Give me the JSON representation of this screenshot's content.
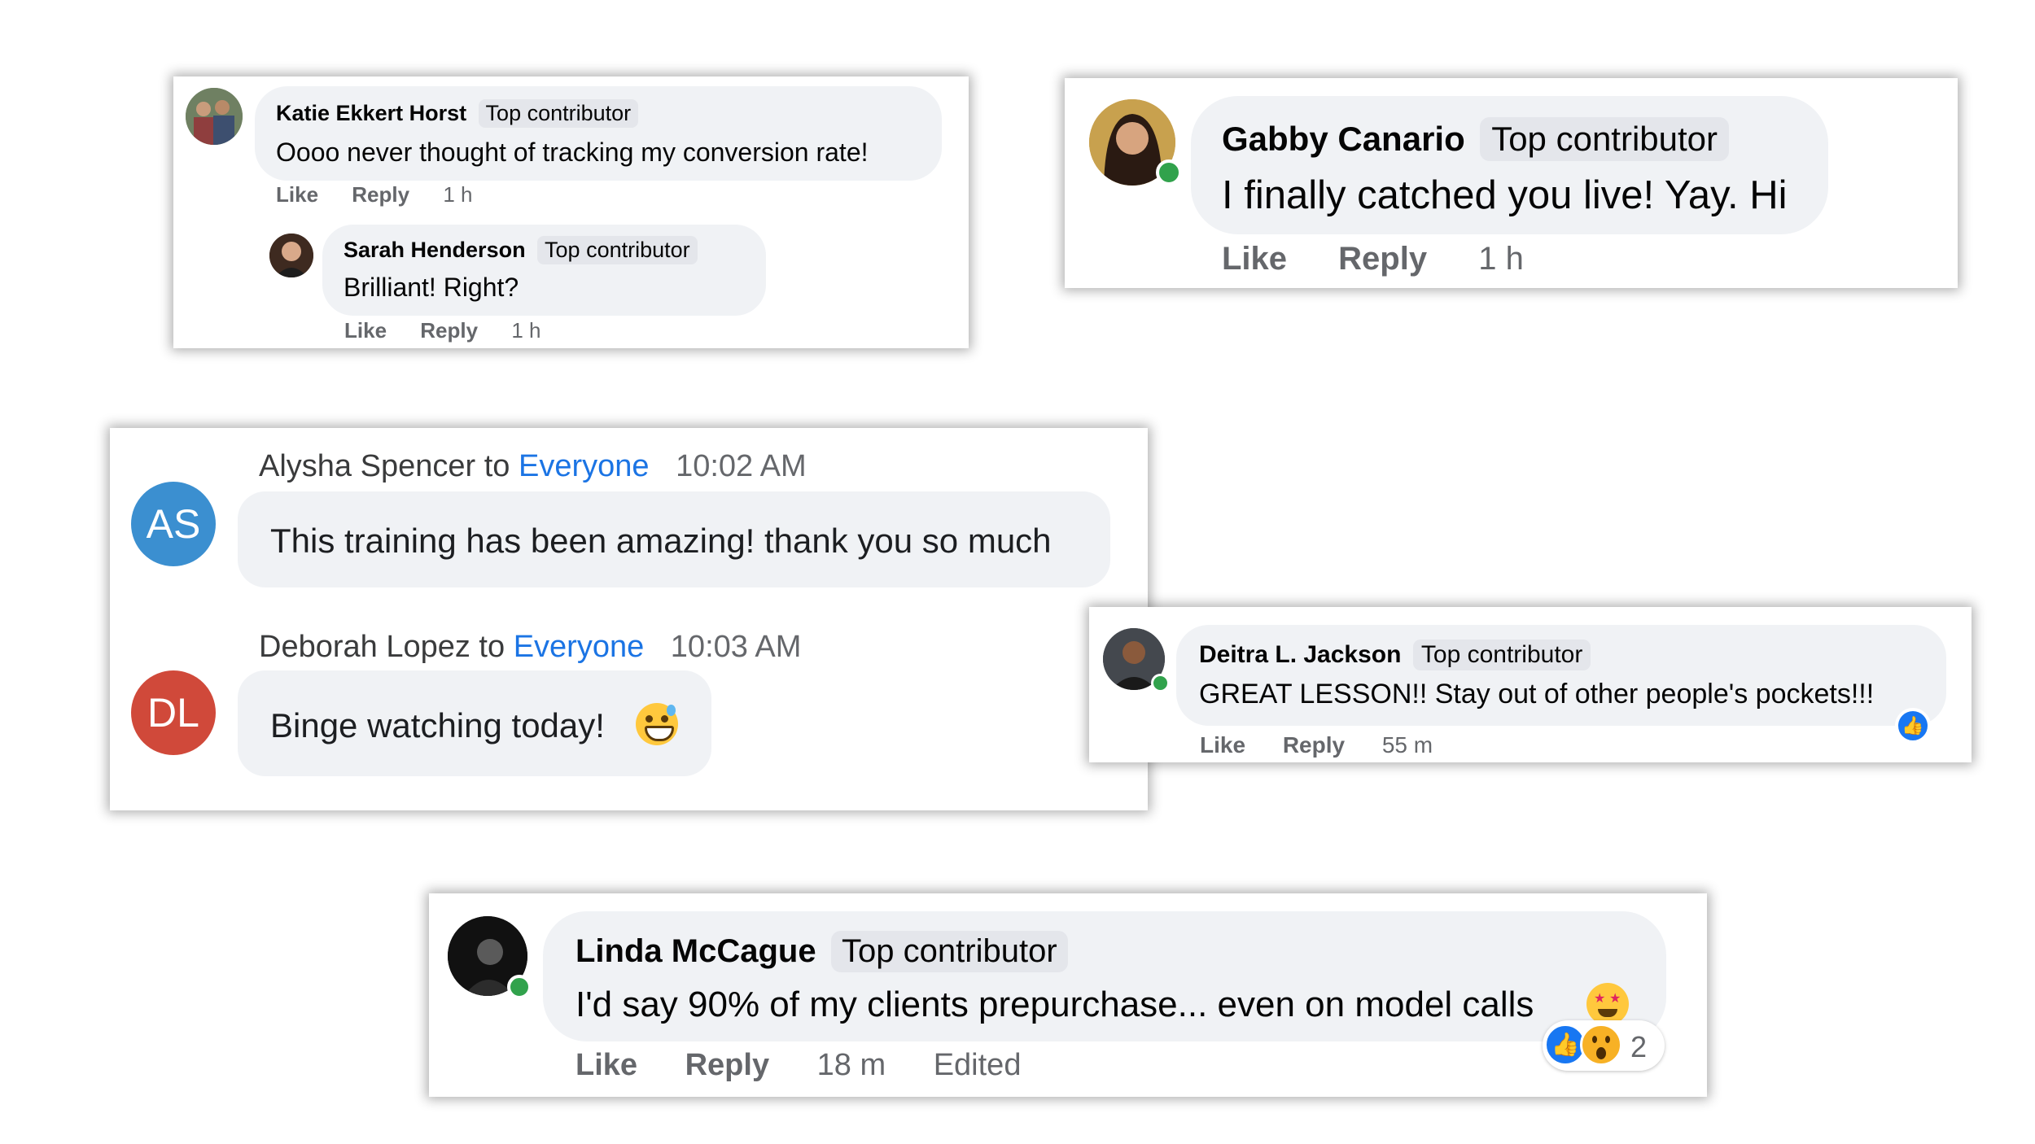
{
  "cards": {
    "katie": {
      "name": "Katie Ekkert Horst",
      "badge": "Top contributor",
      "message": "Oooo never thought of tracking my conversion rate!",
      "like": "Like",
      "reply": "Reply",
      "time": "1 h",
      "reply_comment": {
        "name": "Sarah Henderson",
        "badge": "Top contributor",
        "message": "Brilliant! Right?",
        "like": "Like",
        "reply": "Reply",
        "time": "1 h"
      }
    },
    "gabby": {
      "name": "Gabby Canario",
      "badge": "Top contributor",
      "message": "I finally catched you live! Yay. Hi",
      "like": "Like",
      "reply": "Reply",
      "time": "1 h"
    },
    "chat": {
      "messages": [
        {
          "initials": "AS",
          "sender": "Alysha Spencer",
          "to_word": "to",
          "recipient": "Everyone",
          "time": "10:02 AM",
          "text": "This training has been amazing! thank you so much",
          "avatar_color": "#3b8fd0"
        },
        {
          "initials": "DL",
          "sender": "Deborah Lopez",
          "to_word": "to",
          "recipient": "Everyone",
          "time": "10:03 AM",
          "text": "Binge watching today!",
          "emoji": "grinning-sweat-emoji",
          "avatar_color": "#d0493a"
        }
      ],
      "link_color": "#1b74e4"
    },
    "deitra": {
      "name": "Deitra L. Jackson",
      "badge": "Top contributor",
      "message": "GREAT LESSON!! Stay out of other people's pockets!!!",
      "like": "Like",
      "reply": "Reply",
      "time": "55 m",
      "reaction_icon": "thumbs-up-reaction-icon"
    },
    "linda": {
      "name": "Linda McCague",
      "badge": "Top contributor",
      "message": "I'd say 90% of my clients prepurchase... even on model calls",
      "emoji": "star-struck-emoji",
      "like": "Like",
      "reply": "Reply",
      "time": "18 m",
      "edited": "Edited",
      "reaction_icons": [
        "thumbs-up-reaction-icon",
        "wow-reaction-icon"
      ],
      "reaction_count": "2"
    }
  },
  "colors": {
    "bubble": "#f0f2f5",
    "badge": "#e4e6eb",
    "meta_text": "#65676b",
    "online": "#31a24c",
    "like_blue": "#1877f2"
  }
}
